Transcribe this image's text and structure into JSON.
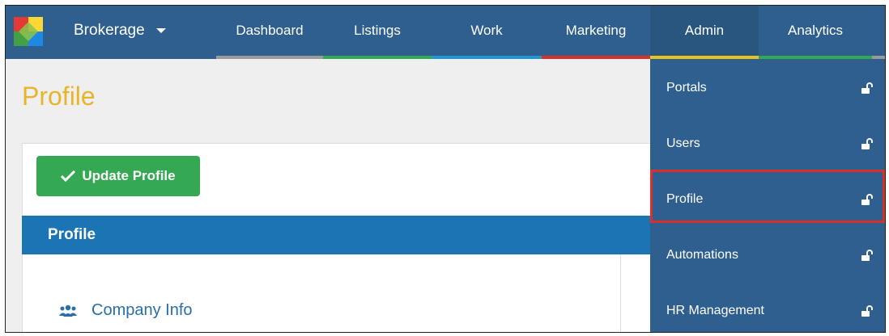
{
  "nav": {
    "brand": "Brokerage",
    "tabs": [
      {
        "label": "Dashboard",
        "color": "#9a9a9a"
      },
      {
        "label": "Listings",
        "color": "#34a853"
      },
      {
        "label": "Work",
        "color": "#2196d3"
      },
      {
        "label": "Marketing",
        "color": "#d9302b"
      },
      {
        "label": "Admin",
        "color": "#e8c21e"
      },
      {
        "label": "Analytics",
        "color": "#34a853"
      }
    ]
  },
  "page": {
    "title": "Profile",
    "update_button": "Update Profile",
    "section_header": "Profile",
    "company_link": "Company Info"
  },
  "dropdown": {
    "items": [
      {
        "label": "Portals",
        "icon": "unlock-icon"
      },
      {
        "label": "Users",
        "icon": "unlock-icon"
      },
      {
        "label": "Profile",
        "icon": "unlock-icon",
        "highlighted": true
      },
      {
        "label": "Automations",
        "icon": "unlock-icon"
      },
      {
        "label": "HR Management",
        "icon": "unlock-icon"
      }
    ]
  },
  "colors": {
    "nav_bg": "#2f5f8f",
    "title": "#e8b52a",
    "update_button": "#34a853",
    "section_bar": "#1b75b4",
    "highlight": "#d9302b"
  }
}
